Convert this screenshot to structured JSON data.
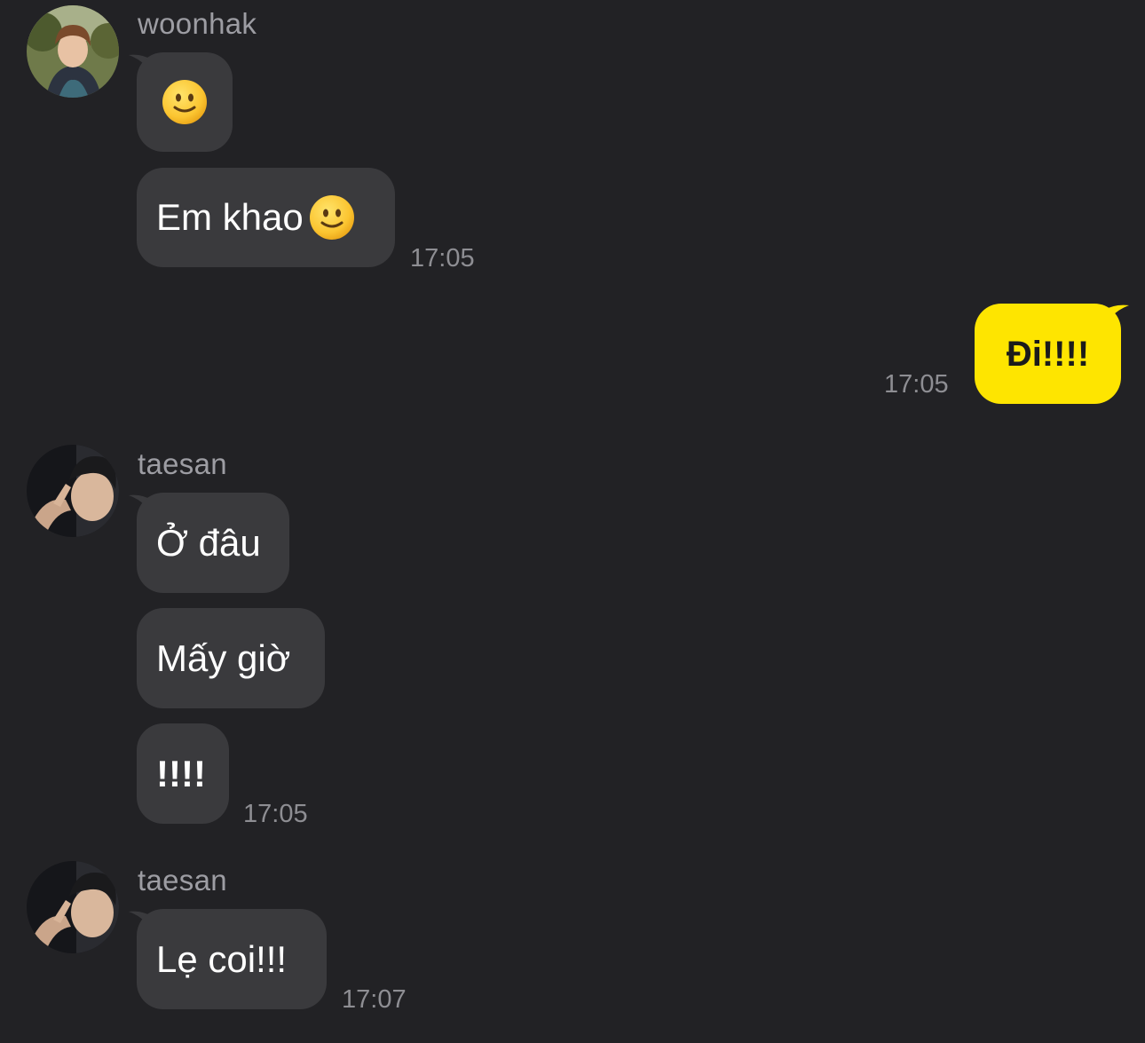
{
  "messages": [
    {
      "sender": "woonhak",
      "bubbles": [
        "🙂",
        "Em khao"
      ],
      "time": "17:05"
    },
    {
      "sender": "me",
      "bubbles": [
        "Đi!!!!"
      ],
      "time": "17:05"
    },
    {
      "sender": "taesan",
      "bubbles": [
        "Ở đâu",
        "Mấy giờ",
        "!!!!"
      ],
      "time": "17:05"
    },
    {
      "sender": "taesan",
      "bubbles": [
        "Lẹ coi!!!"
      ],
      "time": "17:07"
    }
  ],
  "icons": {
    "emoji": "slightly-smiling-face-icon"
  },
  "colors": {
    "background": "#222225",
    "incoming_bubble": "#3a3a3d",
    "outgoing_bubble": "#fee500",
    "sender_name": "#9d9da3",
    "timestamp": "#8e8e93"
  }
}
